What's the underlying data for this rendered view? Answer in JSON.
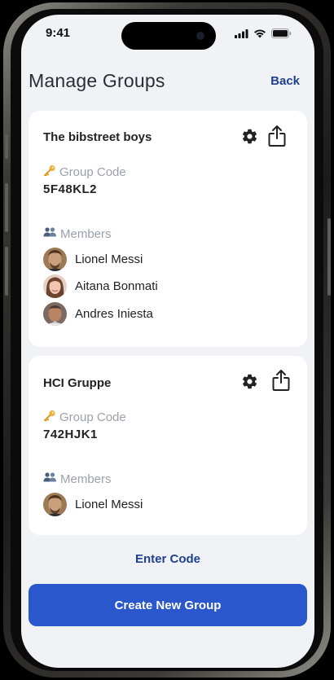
{
  "status_bar": {
    "time": "9:41"
  },
  "header": {
    "title": "Manage Groups",
    "back_label": "Back"
  },
  "labels": {
    "group_code": "Group Code",
    "members": "Members"
  },
  "groups": [
    {
      "name": "The bibstreet boys",
      "code": "5F48KL2",
      "members": [
        "Lionel Messi",
        "Aitana Bonmati",
        "Andres Iniesta"
      ]
    },
    {
      "name": "HCI Gruppe",
      "code": "742HJK1",
      "members": [
        "Lionel Messi"
      ]
    }
  ],
  "actions": {
    "enter_code": "Enter Code",
    "create_group": "Create New Group"
  },
  "colors": {
    "accent": "#2a57cc",
    "link": "#1f3f8f",
    "background": "#f1f2f5"
  },
  "icons": [
    "key-icon",
    "members-icon",
    "gear-icon",
    "share-icon",
    "signal-icon",
    "wifi-icon",
    "battery-icon"
  ]
}
